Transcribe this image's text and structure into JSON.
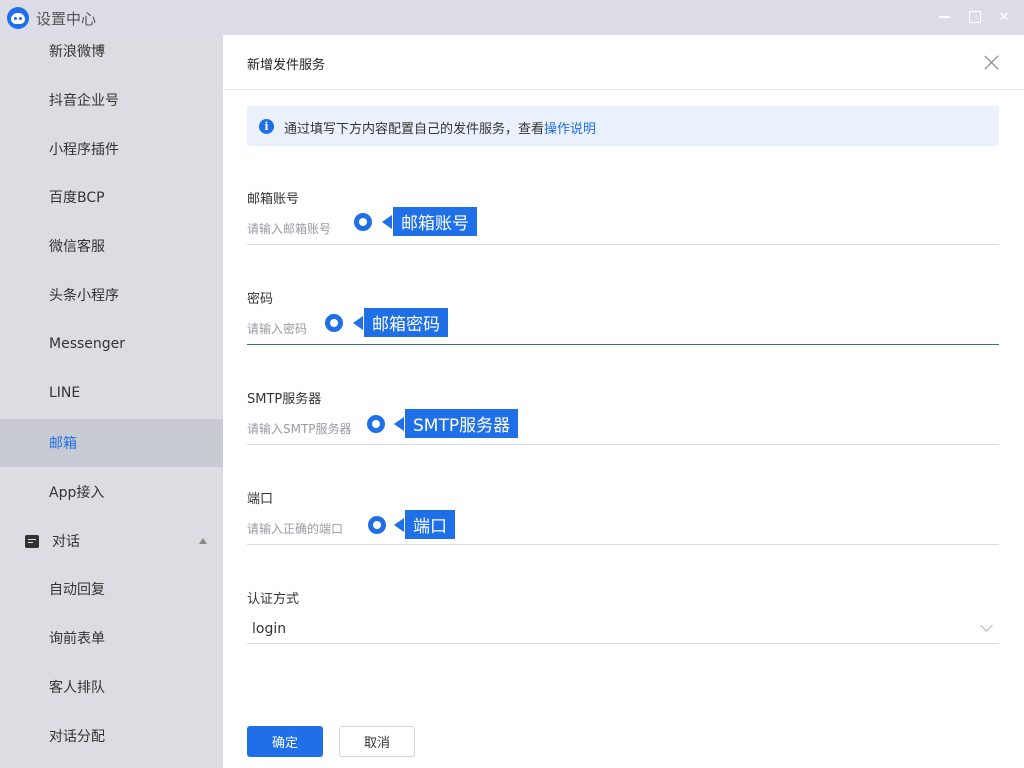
{
  "window": {
    "title": "设置中心"
  },
  "sidebar": {
    "items": [
      {
        "label": "新浪微博",
        "active": false
      },
      {
        "label": "抖音企业号",
        "active": false
      },
      {
        "label": "小程序插件",
        "active": false
      },
      {
        "label": "百度BCP",
        "active": false
      },
      {
        "label": "微信客服",
        "active": false
      },
      {
        "label": "头条小程序",
        "active": false
      },
      {
        "label": "Messenger",
        "active": false
      },
      {
        "label": "LINE",
        "active": false
      },
      {
        "label": "邮箱",
        "active": true
      },
      {
        "label": "App接入",
        "active": false
      }
    ],
    "group": {
      "label": "对话",
      "icon": "chat-icon",
      "expanded": true
    },
    "group_items": [
      {
        "label": "自动回复"
      },
      {
        "label": "询前表单"
      },
      {
        "label": "客人排队"
      },
      {
        "label": "对话分配"
      }
    ]
  },
  "panel": {
    "title": "新增发件服务",
    "info": {
      "text": "通过填写下方内容配置自己的发件服务，查看",
      "link": "操作说明"
    },
    "fields": {
      "email": {
        "label": "邮箱账号",
        "placeholder": "请输入邮箱账号",
        "value": ""
      },
      "password": {
        "label": "密码",
        "placeholder": "请输入密码",
        "value": ""
      },
      "smtp": {
        "label": "SMTP服务器",
        "placeholder": "请输入SMTP服务器",
        "value": ""
      },
      "port": {
        "label": "端口",
        "placeholder": "请输入正确的端口",
        "value": ""
      },
      "auth": {
        "label": "认证方式",
        "value": "login"
      }
    },
    "buttons": {
      "confirm": "确定",
      "cancel": "取消"
    }
  },
  "callouts": {
    "email": "邮箱账号",
    "password": "邮箱密码",
    "smtp": "SMTP服务器",
    "port": "端口"
  },
  "colors": {
    "accent": "#1e6fe8",
    "sidebar_bg": "#dcdde2",
    "titlebar_bg": "#dcdde6",
    "info_bg": "#eaf1fc"
  }
}
